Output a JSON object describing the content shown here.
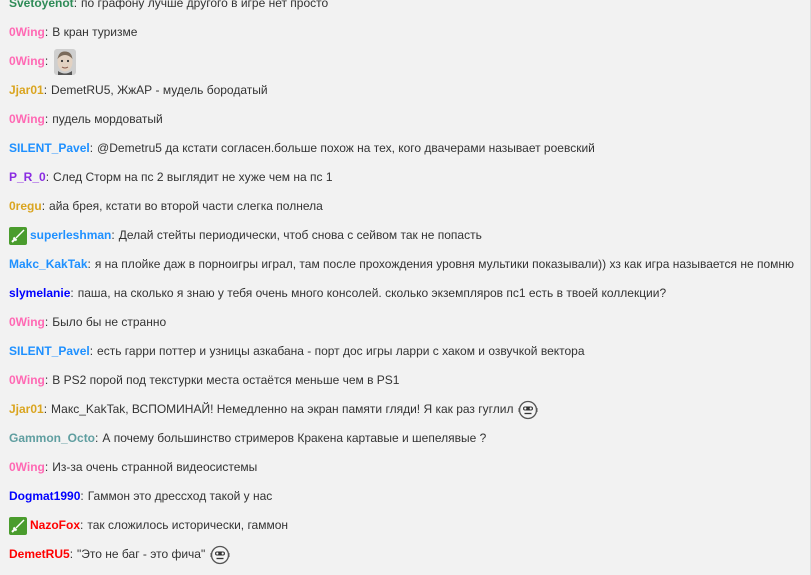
{
  "colors": {
    "background": "#f2f2f2",
    "text": "#333333",
    "mod_badge": "#4a9c2d"
  },
  "messages": [
    {
      "user": "Svetoyenot",
      "color": "#2e8b57",
      "text": "по графону лучше другого в игре нет просто"
    },
    {
      "user": "0Wing",
      "color": "#ff69b4",
      "text": "В кран туризме"
    },
    {
      "user": "0Wing",
      "color": "#ff69b4",
      "text": "",
      "emote": "face-emote"
    },
    {
      "user": "Jjar01",
      "color": "#daa520",
      "text": "DemetRU5, ЖжАР - мудель бородатый"
    },
    {
      "user": "0Wing",
      "color": "#ff69b4",
      "text": "пудель мордоватый"
    },
    {
      "user": "SILENT_Pavel",
      "color": "#1e90ff",
      "text": "@Demetru5 да кстати согласен.больше похож на тех, кого двачерами называет роевский"
    },
    {
      "user": "P_R_0",
      "color": "#8a2be2",
      "text": "След Сторм на пс 2 выглядит не хуже чем на пс 1"
    },
    {
      "user": "0regu",
      "color": "#daa520",
      "text": "айа брея, кстати во второй части слегка полнела"
    },
    {
      "user": "superleshman",
      "color": "#1e90ff",
      "text": "Делай стейты периодически, чтоб снова с сейвом так не попасть",
      "badge": "moderator-sword-icon"
    },
    {
      "user": "Makc_KakTak",
      "color": "#1e90ff",
      "text": "я на плойке даж в порноигры играл, там после прохождения уровня мультики показывали)) хз как игра называется не помню"
    },
    {
      "user": "slymelanie",
      "color": "#0000ff",
      "text": "паша, на сколько я знаю у тебя очень много консолей. сколько экземпляров пс1 есть в твоей коллекции?"
    },
    {
      "user": "0Wing",
      "color": "#ff69b4",
      "text": "Было бы не странно"
    },
    {
      "user": "SILENT_Pavel",
      "color": "#1e90ff",
      "text": "есть гарри поттер и узницы азкабана - порт дос игры ларри с хаком и озвучкой вектора"
    },
    {
      "user": "0Wing",
      "color": "#ff69b4",
      "text": "В PS2 порой под текстурки места остаётся меньше чем в PS1"
    },
    {
      "user": "Jjar01",
      "color": "#daa520",
      "text": "Макс_KakTak, ВСПОМИНАЙ! Немедленно на экран памяти гляди! Я как раз гуглил",
      "emote": "robot-emote"
    },
    {
      "user": "Gammon_Octo",
      "color": "#5f9ea0",
      "text": "А почему большинство стримеров Кракена картавые и шепелявые ?"
    },
    {
      "user": "0Wing",
      "color": "#ff69b4",
      "text": "Из-за очень странной видеосистемы"
    },
    {
      "user": "Dogmat1990",
      "color": "#0000ff",
      "text": "Гаммон это дрессход такой у нас"
    },
    {
      "user": "NazoFox",
      "color": "#ff0000",
      "text": "так сложилось исторически, гаммон",
      "badge": "moderator-sword-icon"
    },
    {
      "user": "DemetRU5",
      "color": "#ff0000",
      "text": "\"Это не баг - это фича\"",
      "emote": "robot-emote"
    }
  ]
}
